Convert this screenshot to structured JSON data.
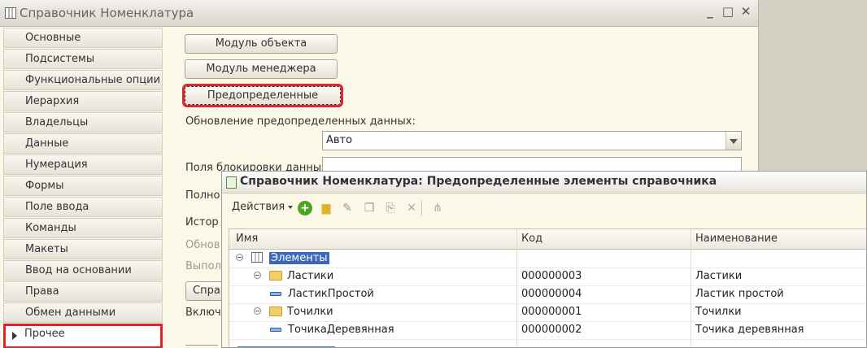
{
  "main_window": {
    "title": "Справочник Номенклатура",
    "controls": {
      "minimize": "_",
      "maximize": "□",
      "close": "✕"
    }
  },
  "nav": {
    "items": [
      "Основные",
      "Подсистемы",
      "Функциональные опции",
      "Иерархия",
      "Владельцы",
      "Данные",
      "Нумерация",
      "Формы",
      "Поле ввода",
      "Команды",
      "Макеты",
      "Ввод на основании",
      "Права",
      "Обмен данными",
      "Прочее"
    ],
    "active_index": 14
  },
  "content": {
    "btn_object_module": "Модуль объекта",
    "btn_manager_module": "Модуль менеджера",
    "btn_predefined": "Предопределенные",
    "update_label": "Обновление предопределенных данных:",
    "update_value": "Авто",
    "lock_fields_label": "Поля блокировки данных:",
    "fulltext_label": "Полно",
    "history_label": "Истор",
    "dim1_label": "Обнов",
    "dim2_label": "Выпол",
    "spra_btn": "Справ",
    "incl_label": "Включ"
  },
  "dialog": {
    "title": "Справочник Номенклатура: Предопределенные элементы справочника",
    "actions_label": "Действия",
    "toolbar_icons": [
      "add-icon",
      "add-folder-icon",
      "edit-icon",
      "copy-icon",
      "paste-icon",
      "delete-icon",
      "hierarchy-icon"
    ],
    "columns": {
      "name": "Имя",
      "code": "Код",
      "title": "Наименование"
    },
    "rows": [
      {
        "name": "Элементы",
        "code": "",
        "title": "",
        "level": 0,
        "kind": "root",
        "expanded": true,
        "selected": true
      },
      {
        "name": "Ластики",
        "code": "000000003",
        "title": "Ластики",
        "level": 1,
        "kind": "folder",
        "expanded": true
      },
      {
        "name": "ЛастикПростой",
        "code": "000000004",
        "title": "Ластик простой",
        "level": 2,
        "kind": "item"
      },
      {
        "name": "Точилки",
        "code": "000000001",
        "title": "Точилки",
        "level": 1,
        "kind": "folder",
        "expanded": true
      },
      {
        "name": "ТочикаДеревянная",
        "code": "000000002",
        "title": "Точика деревянная",
        "level": 2,
        "kind": "item"
      }
    ]
  },
  "colors": {
    "highlight": "#e0202a",
    "selection": "#3c67b6",
    "accent_green": "#4ea524"
  }
}
